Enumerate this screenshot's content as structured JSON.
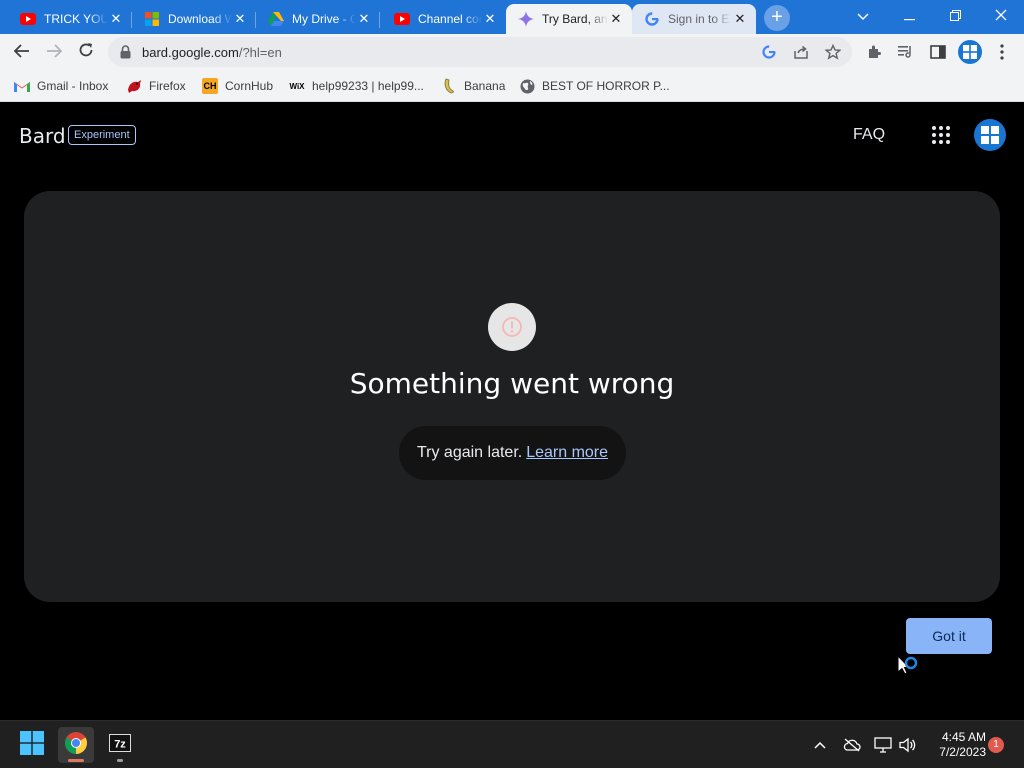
{
  "browser": {
    "tabs": [
      {
        "title": "TRICK YOUR",
        "favicon": "youtube-icon",
        "active": false
      },
      {
        "title": "Download W",
        "favicon": "microsoft-icon",
        "active": false
      },
      {
        "title": "My Drive - G",
        "favicon": "google-drive-icon",
        "active": false
      },
      {
        "title": "Channel cont",
        "favicon": "youtube-icon",
        "active": false
      },
      {
        "title": "Try Bard, an",
        "favicon": "bard-sparkle-icon",
        "active": true
      },
      {
        "title": "Sign in to E",
        "favicon": "google-icon",
        "active": false
      }
    ],
    "url_host": "bard.google.com",
    "url_path": "/?hl=en",
    "bookmarks": [
      {
        "label": "Gmail - Inbox",
        "icon": "gmail-icon"
      },
      {
        "label": "Firefox",
        "icon": "red-bird-icon"
      },
      {
        "label": "CornHub",
        "icon": "ch-logo-icon",
        "icon_text": "CH"
      },
      {
        "label": "help99233 | help99...",
        "icon": "wix-icon",
        "icon_text": "WiX"
      },
      {
        "label": "Banana",
        "icon": "banana-icon"
      },
      {
        "label": "BEST OF HORROR P...",
        "icon": "globe-icon"
      }
    ]
  },
  "page": {
    "brand": "Bard",
    "badge": "Experiment",
    "faq": "FAQ",
    "error": {
      "title": "Something went wrong",
      "message": "Try again later.",
      "link": "Learn more"
    },
    "got_it": "Got it"
  },
  "taskbar": {
    "time": "4:45 AM",
    "date": "7/2/2023",
    "notification_count": "1"
  },
  "colors": {
    "tabstrip": "#1f74d6",
    "card": "#1f2022",
    "accent": "#8ab4f8",
    "link": "#a8c7fa"
  }
}
